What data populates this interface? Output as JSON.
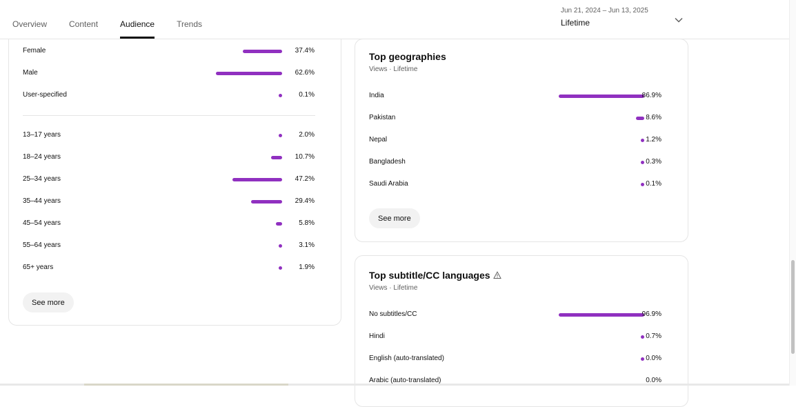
{
  "tabs": [
    {
      "label": "Overview",
      "active": false
    },
    {
      "label": "Content",
      "active": false
    },
    {
      "label": "Audience",
      "active": true
    },
    {
      "label": "Trends",
      "active": false
    }
  ],
  "date_picker": {
    "range": "Jun 21, 2024 – Jun 13, 2025",
    "period": "Lifetime",
    "icon": "chevron-down-icon"
  },
  "gender": [
    {
      "label": "Female",
      "pct": "37.4%",
      "value": 37.4
    },
    {
      "label": "Male",
      "pct": "62.6%",
      "value": 62.6
    },
    {
      "label": "User-specified",
      "pct": "0.1%",
      "value": 0.1
    }
  ],
  "age": [
    {
      "label": "13–17 years",
      "pct": "2.0%",
      "value": 2.0
    },
    {
      "label": "18–24 years",
      "pct": "10.7%",
      "value": 10.7
    },
    {
      "label": "25–34 years",
      "pct": "47.2%",
      "value": 47.2
    },
    {
      "label": "35–44 years",
      "pct": "29.4%",
      "value": 29.4
    },
    {
      "label": "45–54 years",
      "pct": "5.8%",
      "value": 5.8
    },
    {
      "label": "55–64 years",
      "pct": "3.1%",
      "value": 3.1
    },
    {
      "label": "65+ years",
      "pct": "1.9%",
      "value": 1.9
    }
  ],
  "left_card": {
    "see_more": "See more"
  },
  "geographies": {
    "title": "Top geographies",
    "subtitle": "Views · Lifetime",
    "see_more": "See more",
    "items": [
      {
        "label": "India",
        "pct": "86.9%",
        "value": 86.9
      },
      {
        "label": "Pakistan",
        "pct": "8.6%",
        "value": 8.6
      },
      {
        "label": "Nepal",
        "pct": "1.2%",
        "value": 1.2
      },
      {
        "label": "Bangladesh",
        "pct": "0.3%",
        "value": 0.3
      },
      {
        "label": "Saudi Arabia",
        "pct": "0.1%",
        "value": 0.1
      }
    ]
  },
  "languages": {
    "title": "Top subtitle/CC languages",
    "subtitle": "Views · Lifetime",
    "warning_icon": "warning-icon",
    "items": [
      {
        "label": "No subtitles/CC",
        "pct": "96.9%",
        "value": 96.9
      },
      {
        "label": "Hindi",
        "pct": "0.7%",
        "value": 0.7
      },
      {
        "label": "English (auto-translated)",
        "pct": "0.0%",
        "value": 0.05
      },
      {
        "label": "Arabic (auto-translated)",
        "pct": "0.0%",
        "value": 0.0
      }
    ]
  },
  "colors": {
    "bar": "#9030c0"
  }
}
